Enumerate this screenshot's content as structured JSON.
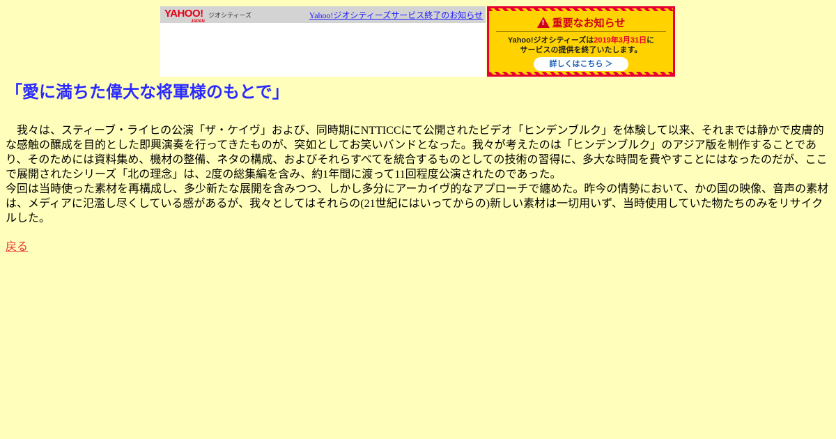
{
  "header": {
    "logo_text": "YAHOO!",
    "logo_sub": "JAPAN",
    "service_name": "ジオシティーズ",
    "notice_link": "Yahoo!ジオシティーズサービス終了のお知らせ"
  },
  "important_notice": {
    "title": "重要なお知らせ",
    "line1_prefix": "Yahoo!ジオシティーズは",
    "line1_date": "2019年3月31日",
    "line1_suffix": "に",
    "line2": "サービスの提供を終了いたします。",
    "button_label": "詳しくはこちら ＞",
    "colors": {
      "background": "#ffd200",
      "accent": "#e60033"
    }
  },
  "page": {
    "title": "「愛に満ちた偉大な将軍様のもとで」",
    "paragraph1": "　我々は、スティーブ・ライヒの公演「ザ・ケイヴ」および、同時期にNTTICCにて公開されたビデオ「ヒンデンブルク」を体験して以来、それまでは静かで皮膚的な感触の醸成を目的とした即興演奏を行ってきたものが、突如としてお笑いバンドとなった。我々が考えたのは「ヒンデンブルク」のアジア版を制作することであり、そのためには資料集め、機材の整備、ネタの構成、およびそれらすべてを統合するものとしての技術の習得に、多大な時間を費やすことにはなったのだが、ここで展開されたシリーズ「北の理念」は、2度の総集編を含み、約1年間に渡って11回程度公演されたのであった。",
    "paragraph2": "今回は当時使った素材を再構成し、多少新たな展開を含みつつ、しかし多分にアーカイヴ的なアプローチで纏めた。昨今の情勢において、かの国の映像、音声の素材は、メディアに氾濫し尽くしている感があるが、我々としてはそれらの(21世紀にはいってからの)新しい素材は一切用いず、当時使用していた物たちのみをリサイクルした。",
    "back_link": "戻る"
  }
}
